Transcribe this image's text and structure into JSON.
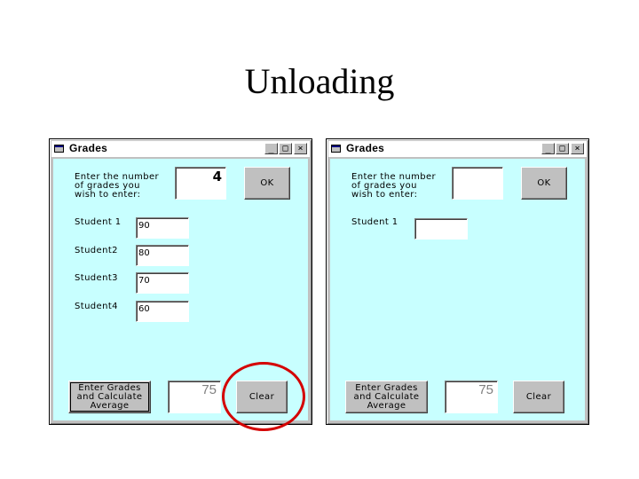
{
  "slide": {
    "title": "Unloading"
  },
  "colors": {
    "client_bg": "#c8ffff",
    "highlight_ring": "#d40000"
  },
  "windows": [
    {
      "title": "Grades",
      "controls": {
        "minimize": "_",
        "maximize": "□",
        "close": "×"
      },
      "prompt_lines": [
        "Enter the number",
        "of grades you",
        "wish to enter:"
      ],
      "count_value": "4",
      "ok_label": "OK",
      "students": [
        {
          "label": "Student 1",
          "value": "90"
        },
        {
          "label": "Student2",
          "value": "80"
        },
        {
          "label": "Student3",
          "value": "70"
        },
        {
          "label": "Student4",
          "value": "60"
        }
      ],
      "calc_label_lines": [
        "Enter Grades",
        "and Calculate",
        "Average"
      ],
      "average_value": "75",
      "clear_label": "Clear"
    },
    {
      "title": "Grades",
      "controls": {
        "minimize": "_",
        "maximize": "□",
        "close": "×"
      },
      "prompt_lines": [
        "Enter the number",
        "of grades you",
        "wish to enter:"
      ],
      "count_value": "",
      "ok_label": "OK",
      "students": [
        {
          "label": "Student 1",
          "value": ""
        }
      ],
      "calc_label_lines": [
        "Enter Grades",
        "and Calculate",
        "Average"
      ],
      "average_value": "75",
      "clear_label": "Clear"
    }
  ]
}
